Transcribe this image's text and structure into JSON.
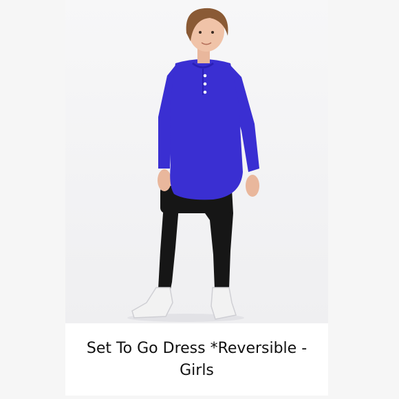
{
  "listing": {
    "title": "Set To Go Dress *Reversible - Girls",
    "dress_color": "#3a2fd2",
    "leggings_color": "#161616",
    "shoes_color": "#f2f2f2"
  }
}
